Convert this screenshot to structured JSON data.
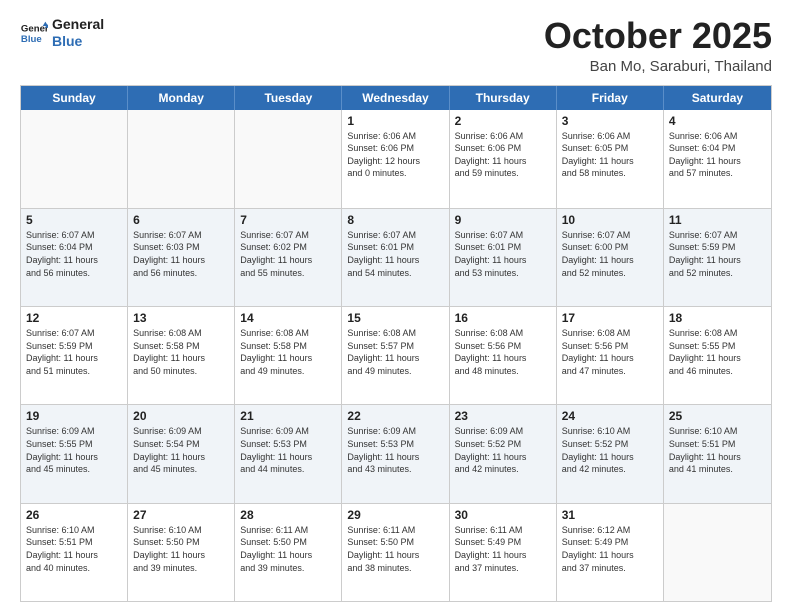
{
  "header": {
    "logo_line1": "General",
    "logo_line2": "Blue",
    "month": "October 2025",
    "location": "Ban Mo, Saraburi, Thailand"
  },
  "weekdays": [
    "Sunday",
    "Monday",
    "Tuesday",
    "Wednesday",
    "Thursday",
    "Friday",
    "Saturday"
  ],
  "weeks": [
    [
      {
        "day": "",
        "info": ""
      },
      {
        "day": "",
        "info": ""
      },
      {
        "day": "",
        "info": ""
      },
      {
        "day": "1",
        "info": "Sunrise: 6:06 AM\nSunset: 6:06 PM\nDaylight: 12 hours\nand 0 minutes."
      },
      {
        "day": "2",
        "info": "Sunrise: 6:06 AM\nSunset: 6:06 PM\nDaylight: 11 hours\nand 59 minutes."
      },
      {
        "day": "3",
        "info": "Sunrise: 6:06 AM\nSunset: 6:05 PM\nDaylight: 11 hours\nand 58 minutes."
      },
      {
        "day": "4",
        "info": "Sunrise: 6:06 AM\nSunset: 6:04 PM\nDaylight: 11 hours\nand 57 minutes."
      }
    ],
    [
      {
        "day": "5",
        "info": "Sunrise: 6:07 AM\nSunset: 6:04 PM\nDaylight: 11 hours\nand 56 minutes."
      },
      {
        "day": "6",
        "info": "Sunrise: 6:07 AM\nSunset: 6:03 PM\nDaylight: 11 hours\nand 56 minutes."
      },
      {
        "day": "7",
        "info": "Sunrise: 6:07 AM\nSunset: 6:02 PM\nDaylight: 11 hours\nand 55 minutes."
      },
      {
        "day": "8",
        "info": "Sunrise: 6:07 AM\nSunset: 6:01 PM\nDaylight: 11 hours\nand 54 minutes."
      },
      {
        "day": "9",
        "info": "Sunrise: 6:07 AM\nSunset: 6:01 PM\nDaylight: 11 hours\nand 53 minutes."
      },
      {
        "day": "10",
        "info": "Sunrise: 6:07 AM\nSunset: 6:00 PM\nDaylight: 11 hours\nand 52 minutes."
      },
      {
        "day": "11",
        "info": "Sunrise: 6:07 AM\nSunset: 5:59 PM\nDaylight: 11 hours\nand 52 minutes."
      }
    ],
    [
      {
        "day": "12",
        "info": "Sunrise: 6:07 AM\nSunset: 5:59 PM\nDaylight: 11 hours\nand 51 minutes."
      },
      {
        "day": "13",
        "info": "Sunrise: 6:08 AM\nSunset: 5:58 PM\nDaylight: 11 hours\nand 50 minutes."
      },
      {
        "day": "14",
        "info": "Sunrise: 6:08 AM\nSunset: 5:58 PM\nDaylight: 11 hours\nand 49 minutes."
      },
      {
        "day": "15",
        "info": "Sunrise: 6:08 AM\nSunset: 5:57 PM\nDaylight: 11 hours\nand 49 minutes."
      },
      {
        "day": "16",
        "info": "Sunrise: 6:08 AM\nSunset: 5:56 PM\nDaylight: 11 hours\nand 48 minutes."
      },
      {
        "day": "17",
        "info": "Sunrise: 6:08 AM\nSunset: 5:56 PM\nDaylight: 11 hours\nand 47 minutes."
      },
      {
        "day": "18",
        "info": "Sunrise: 6:08 AM\nSunset: 5:55 PM\nDaylight: 11 hours\nand 46 minutes."
      }
    ],
    [
      {
        "day": "19",
        "info": "Sunrise: 6:09 AM\nSunset: 5:55 PM\nDaylight: 11 hours\nand 45 minutes."
      },
      {
        "day": "20",
        "info": "Sunrise: 6:09 AM\nSunset: 5:54 PM\nDaylight: 11 hours\nand 45 minutes."
      },
      {
        "day": "21",
        "info": "Sunrise: 6:09 AM\nSunset: 5:53 PM\nDaylight: 11 hours\nand 44 minutes."
      },
      {
        "day": "22",
        "info": "Sunrise: 6:09 AM\nSunset: 5:53 PM\nDaylight: 11 hours\nand 43 minutes."
      },
      {
        "day": "23",
        "info": "Sunrise: 6:09 AM\nSunset: 5:52 PM\nDaylight: 11 hours\nand 42 minutes."
      },
      {
        "day": "24",
        "info": "Sunrise: 6:10 AM\nSunset: 5:52 PM\nDaylight: 11 hours\nand 42 minutes."
      },
      {
        "day": "25",
        "info": "Sunrise: 6:10 AM\nSunset: 5:51 PM\nDaylight: 11 hours\nand 41 minutes."
      }
    ],
    [
      {
        "day": "26",
        "info": "Sunrise: 6:10 AM\nSunset: 5:51 PM\nDaylight: 11 hours\nand 40 minutes."
      },
      {
        "day": "27",
        "info": "Sunrise: 6:10 AM\nSunset: 5:50 PM\nDaylight: 11 hours\nand 39 minutes."
      },
      {
        "day": "28",
        "info": "Sunrise: 6:11 AM\nSunset: 5:50 PM\nDaylight: 11 hours\nand 39 minutes."
      },
      {
        "day": "29",
        "info": "Sunrise: 6:11 AM\nSunset: 5:50 PM\nDaylight: 11 hours\nand 38 minutes."
      },
      {
        "day": "30",
        "info": "Sunrise: 6:11 AM\nSunset: 5:49 PM\nDaylight: 11 hours\nand 37 minutes."
      },
      {
        "day": "31",
        "info": "Sunrise: 6:12 AM\nSunset: 5:49 PM\nDaylight: 11 hours\nand 37 minutes."
      },
      {
        "day": "",
        "info": ""
      }
    ]
  ]
}
